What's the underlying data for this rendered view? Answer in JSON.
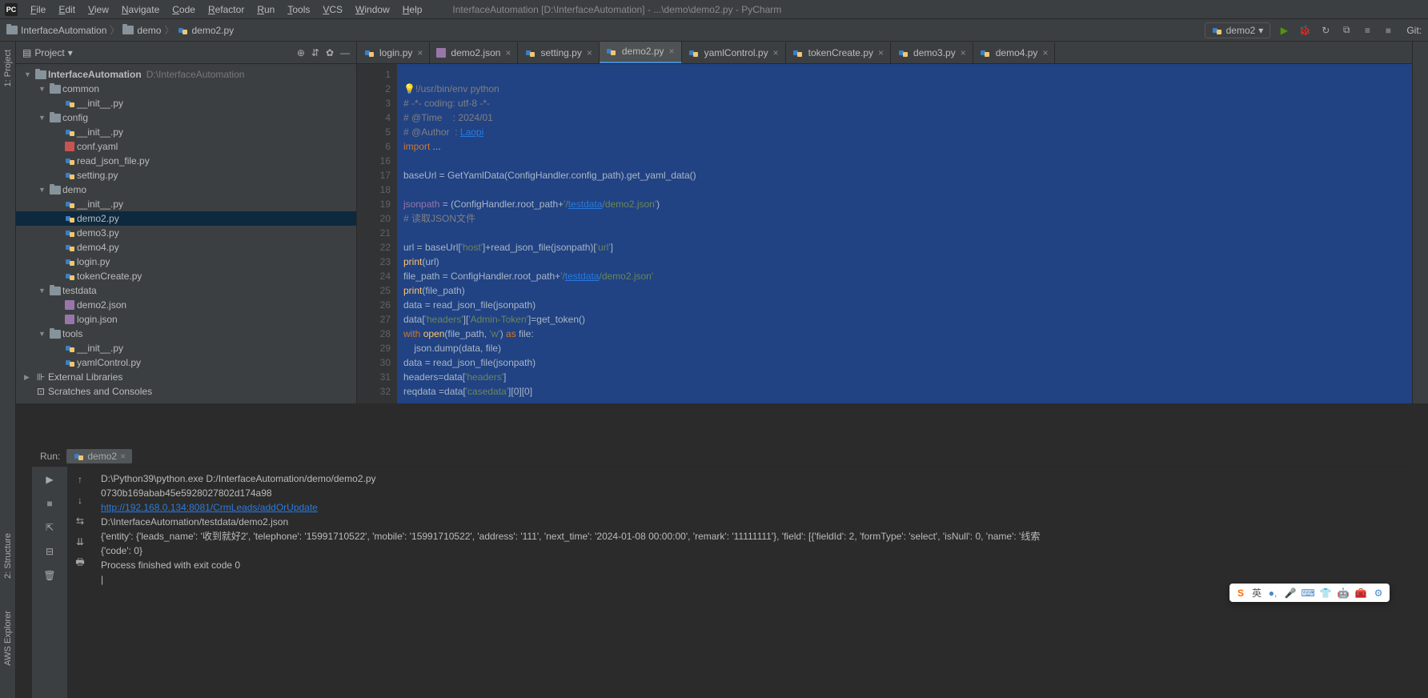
{
  "menu": [
    "File",
    "Edit",
    "View",
    "Navigate",
    "Code",
    "Refactor",
    "Run",
    "Tools",
    "VCS",
    "Window",
    "Help"
  ],
  "window_title": "InterfaceAutomation [D:\\InterfaceAutomation] - ...\\demo\\demo2.py - PyCharm",
  "breadcrumb": [
    {
      "label": "InterfaceAutomation",
      "icon": "folder"
    },
    {
      "label": "demo",
      "icon": "folder"
    },
    {
      "label": "demo2.py",
      "icon": "py"
    }
  ],
  "run_config": {
    "name": "demo2"
  },
  "git_label": "Git:",
  "panel": {
    "title": "Project"
  },
  "left_tools": [
    "1: Project",
    "2: Structure",
    "AWS Explorer"
  ],
  "tree": [
    {
      "depth": 0,
      "arrow": "▼",
      "icon": "folder",
      "label": "InterfaceAutomation",
      "path": "D:\\InterfaceAutomation",
      "bold": true
    },
    {
      "depth": 1,
      "arrow": "▼",
      "icon": "folder",
      "label": "common"
    },
    {
      "depth": 2,
      "arrow": "",
      "icon": "py",
      "label": "__init__.py"
    },
    {
      "depth": 1,
      "arrow": "▼",
      "icon": "folder",
      "label": "config"
    },
    {
      "depth": 2,
      "arrow": "",
      "icon": "py",
      "label": "__init__.py"
    },
    {
      "depth": 2,
      "arrow": "",
      "icon": "yaml",
      "label": "conf.yaml"
    },
    {
      "depth": 2,
      "arrow": "",
      "icon": "py",
      "label": "read_json_file.py"
    },
    {
      "depth": 2,
      "arrow": "",
      "icon": "py",
      "label": "setting.py"
    },
    {
      "depth": 1,
      "arrow": "▼",
      "icon": "folder",
      "label": "demo"
    },
    {
      "depth": 2,
      "arrow": "",
      "icon": "py",
      "label": "__init__.py"
    },
    {
      "depth": 2,
      "arrow": "",
      "icon": "py",
      "label": "demo2.py",
      "selected": true
    },
    {
      "depth": 2,
      "arrow": "",
      "icon": "py",
      "label": "demo3.py"
    },
    {
      "depth": 2,
      "arrow": "",
      "icon": "py",
      "label": "demo4.py"
    },
    {
      "depth": 2,
      "arrow": "",
      "icon": "py",
      "label": "login.py"
    },
    {
      "depth": 2,
      "arrow": "",
      "icon": "py",
      "label": "tokenCreate.py"
    },
    {
      "depth": 1,
      "arrow": "▼",
      "icon": "folder",
      "label": "testdata"
    },
    {
      "depth": 2,
      "arrow": "",
      "icon": "json",
      "label": "demo2.json"
    },
    {
      "depth": 2,
      "arrow": "",
      "icon": "json",
      "label": "login.json"
    },
    {
      "depth": 1,
      "arrow": "▼",
      "icon": "folder",
      "label": "tools"
    },
    {
      "depth": 2,
      "arrow": "",
      "icon": "py",
      "label": "__init__.py"
    },
    {
      "depth": 2,
      "arrow": "",
      "icon": "py",
      "label": "yamlControl.py"
    },
    {
      "depth": 0,
      "arrow": "▶",
      "icon": "lib",
      "label": "External Libraries"
    },
    {
      "depth": 0,
      "arrow": "",
      "icon": "scratch",
      "label": "Scratches and Consoles"
    }
  ],
  "tabs": [
    {
      "label": "login.py",
      "icon": "py"
    },
    {
      "label": "demo2.json",
      "icon": "json"
    },
    {
      "label": "setting.py",
      "icon": "py"
    },
    {
      "label": "demo2.py",
      "icon": "py",
      "active": true
    },
    {
      "label": "yamlControl.py",
      "icon": "py"
    },
    {
      "label": "tokenCreate.py",
      "icon": "py"
    },
    {
      "label": "demo3.py",
      "icon": "py"
    },
    {
      "label": "demo4.py",
      "icon": "py"
    }
  ],
  "code_lines": [
    {
      "n": 1,
      "html": ""
    },
    {
      "n": 2,
      "html": "<span class='bulb'>💡</span><span class='c'>!/usr/bin/env python</span>"
    },
    {
      "n": 3,
      "html": "<span class='c'># -*- coding: utf-8 -*-</span>"
    },
    {
      "n": 4,
      "html": "<span class='c'># @Time    : 2024/01</span>"
    },
    {
      "n": 5,
      "html": "<span class='c'># @Author  : <span class='link'>Laopi</span></span>"
    },
    {
      "n": 6,
      "html": "<span class='k'>import</span> ..."
    },
    {
      "n": 16,
      "html": ""
    },
    {
      "n": 17,
      "html": "baseUrl = GetYamlData(ConfigHandler.config_path).get_yaml_data()"
    },
    {
      "n": 18,
      "html": ""
    },
    {
      "n": 19,
      "html": "<span class='n'>jsonpath</span> = (ConfigHandler.root_path+<span class='s'>'/<span class='link'>testdata</span>/demo2.json'</span>)"
    },
    {
      "n": 20,
      "html": "<span class='c'># 读取JSON文件</span>"
    },
    {
      "n": 21,
      "html": ""
    },
    {
      "n": 22,
      "html": "url = baseUrl[<span class='s'>'host'</span>]+read_json_file(jsonpath)[<span class='s'>'url'</span>]"
    },
    {
      "n": 23,
      "html": "<span class='f'>print</span>(url)"
    },
    {
      "n": 24,
      "html": "file_path = ConfigHandler.root_path+<span class='s'>'/<span class='link'>testdata</span>/demo2.json'</span>"
    },
    {
      "n": 25,
      "html": "<span class='f'>print</span>(file_path)"
    },
    {
      "n": 26,
      "html": "data = read_json_file(jsonpath)"
    },
    {
      "n": 27,
      "html": "data[<span class='s'>'headers'</span>][<span class='s'>'Admin-Token'</span>]=get_token()"
    },
    {
      "n": 28,
      "html": "<span class='k'>with</span> <span class='f'>open</span>(file_path, <span class='s'>'w'</span>) <span class='k'>as</span> file:"
    },
    {
      "n": 29,
      "html": "    json.dump(data, file)"
    },
    {
      "n": 30,
      "html": "data = read_json_file(jsonpath)"
    },
    {
      "n": 31,
      "html": "headers=data[<span class='s'>'headers'</span>]"
    },
    {
      "n": 32,
      "html": "reqdata =data[<span class='s'>'casedata'</span>][0][0]"
    }
  ],
  "run": {
    "label": "Run:",
    "tab_name": "demo2",
    "lines": [
      "D:\\Python39\\python.exe D:/InterfaceAutomation/demo/demo2.py",
      "0730b169abab45e5928027802d174a98",
      "",
      "D:\\InterfaceAutomation/testdata/demo2.json",
      "{'entity': {'leads_name': '收到就好2', 'telephone': '15991710522', 'mobile': '15991710522', 'address': '111', 'next_time': '2024-01-08 00:00:00', 'remark': '11111111'}, 'field': [{'fieldId': 2, 'formType': 'select', 'isNull': 0, 'name': '线索",
      "{'code': 0}",
      "",
      "Process finished with exit code 0",
      "|"
    ],
    "link": "http://192.168.0.134:8081/CrmLeads/addOrUpdate"
  },
  "ime": {
    "mode": "英"
  }
}
